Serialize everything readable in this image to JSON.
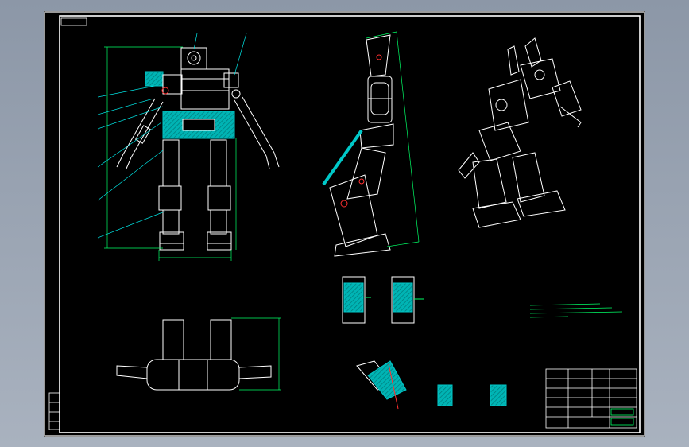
{
  "drawing": {
    "type": "CAD assembly drawing",
    "views": [
      "front-view",
      "side-view",
      "isometric-view",
      "top-view",
      "detail-joint-views",
      "detail-section-views"
    ],
    "colors": {
      "background": "#000000",
      "outline": "#ffffff",
      "dimension": "#00ff66",
      "hatch": "#00c8c8",
      "leader": "#00e5e5",
      "accent": "#ff3030",
      "frame_backdrop": "#9aa3b0"
    }
  }
}
